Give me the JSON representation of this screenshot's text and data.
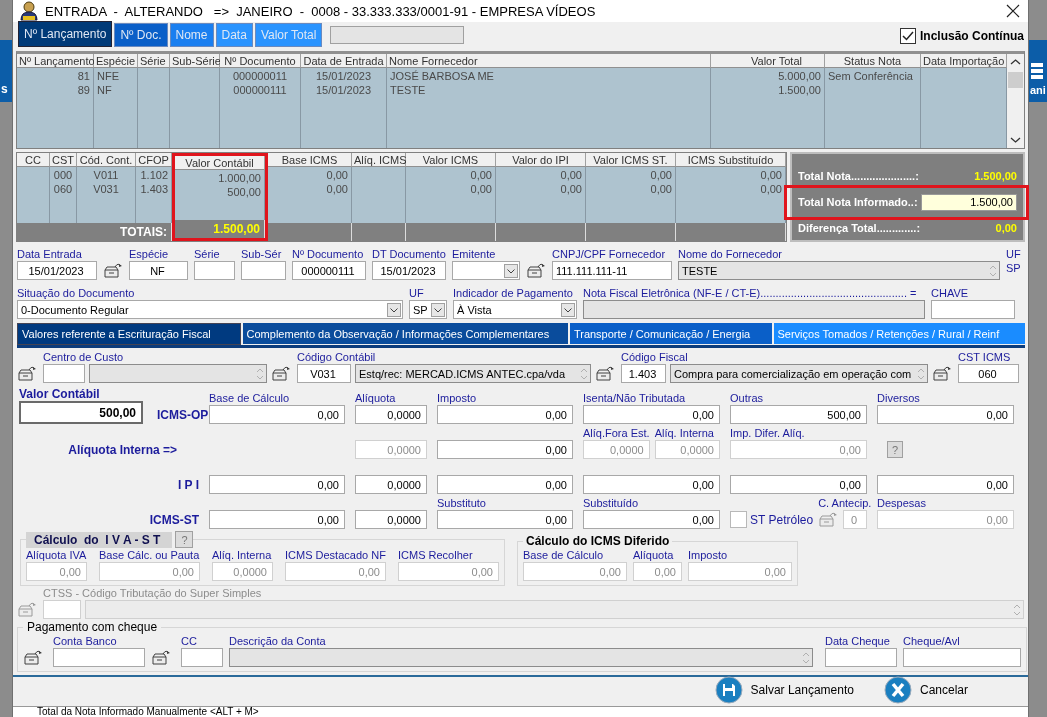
{
  "background_app": {
    "left_label": "s",
    "right_label": "ani"
  },
  "window": {
    "title": "ENTRADA  -  ALTERANDO   =>  JANEIRO  -  0008 - 33.333.333/0001-91 - EMPRESA VÍDEOS"
  },
  "search_tabs": [
    {
      "label": "Nº Lançamento",
      "selected": true
    },
    {
      "label": "Nº Doc.",
      "selected": false
    },
    {
      "label": "Nome",
      "selected": false
    },
    {
      "label": "Data",
      "selected": false
    },
    {
      "label": "Valor Total",
      "selected": false
    }
  ],
  "inclusao_continua": {
    "label": "Inclusão Contínua",
    "checked": true
  },
  "entries_table": {
    "columns": [
      "Nº Lançamento",
      "Espécie",
      "Série",
      "Sub-Série",
      "Nº Documento",
      "Data de Entrada",
      "Nome Fornecedor",
      "Valor Total",
      "Status Nota",
      "Data Importação"
    ],
    "rows": [
      [
        "81",
        "NFE",
        null,
        null,
        "000000011",
        "15/01/2023",
        "JOSÉ BARBOSA ME",
        "5.000,00",
        "Sem Conferência",
        null
      ],
      [
        "89",
        "NF",
        null,
        null,
        "000000111",
        "15/01/2023",
        "TESTE",
        "1.500,00",
        null,
        null
      ]
    ]
  },
  "items_table": {
    "columns": [
      {
        "label": "CC",
        "highlighted": false
      },
      {
        "label": "CST",
        "highlighted": false
      },
      {
        "label": "Cód. Cont.",
        "highlighted": false
      },
      {
        "label": "CFOP",
        "highlighted": false
      },
      {
        "label": "Valor Contábil",
        "highlighted": true
      },
      {
        "label": "Base ICMS",
        "highlighted": false
      },
      {
        "label": "Alíq. ICMS",
        "highlighted": false
      },
      {
        "label": "Valor ICMS",
        "highlighted": false
      },
      {
        "label": "Valor do IPI",
        "highlighted": false
      },
      {
        "label": "Valor ICMS ST.",
        "highlighted": false
      },
      {
        "label": "ICMS Substituído",
        "highlighted": false
      }
    ],
    "rows": [
      [
        null,
        "000",
        "V011",
        "1.102",
        "1.000,00",
        "0,00",
        null,
        "0,00",
        "0,00",
        "0,00",
        "0,00"
      ],
      [
        null,
        "060",
        "V031",
        "1.403",
        "500,00",
        "0,00",
        null,
        "0,00",
        "0,00",
        "0,00",
        "0,00"
      ]
    ],
    "totals": {
      "label": "TOTAIS:",
      "value": "1.500,00"
    }
  },
  "totals_panel": [
    {
      "kind": "text",
      "label": "Total Nota.....................:",
      "value": "1.500,00",
      "highlighted": false
    },
    {
      "kind": "input",
      "label": "Total Nota Informado..:",
      "value": "1.500,00",
      "highlighted": true
    },
    {
      "kind": "text",
      "label": "Diferença Total.............:",
      "value": "0,00",
      "highlighted": false
    }
  ],
  "document_rows": [
    [
      {
        "kind": "field",
        "label": "Data Entrada",
        "value": "15/01/2023",
        "disabled": false
      },
      {
        "kind": "lookup",
        "disabled": false
      },
      {
        "kind": "field",
        "label": "Espécie",
        "value": "NF",
        "disabled": false
      },
      {
        "kind": "field",
        "label": "Série",
        "disabled": false
      },
      {
        "kind": "field",
        "label": "Sub-Sér",
        "disabled": false
      },
      {
        "kind": "field",
        "label": "Nº Documento",
        "value": "000000111",
        "disabled": false
      },
      {
        "kind": "field",
        "label": "DT Documento",
        "value": "15/01/2023",
        "disabled": false
      },
      {
        "kind": "combo",
        "label": "Emitente",
        "disabled": false
      },
      {
        "kind": "lookup",
        "disabled": false
      },
      {
        "kind": "field",
        "label": "CNPJ/CPF Fornecedor",
        "value": "111.111.111-11",
        "disabled": false
      },
      {
        "kind": "spin",
        "label": "Nome do Fornecedor",
        "value": "TESTE",
        "disabled": false
      },
      {
        "kind": "label",
        "label": "UF",
        "value": "SP"
      }
    ],
    [
      {
        "kind": "combo",
        "label": "Situação do Documento",
        "value": "0-Documento Regular",
        "disabled": false
      },
      {
        "kind": "combo",
        "label": "UF",
        "value": "SP",
        "disabled": false
      },
      {
        "kind": "combo",
        "label": "Indicador de Pagamento",
        "value": "À Vista",
        "disabled": false
      },
      {
        "kind": "readonly",
        "label": "Nota Fiscal Eletrônica (NF-E / CT-E)................................................  =",
        "disabled": false
      },
      {
        "kind": "field",
        "label": "CHAVE",
        "disabled": false
      }
    ]
  ],
  "section_tabs": [
    {
      "label": "Valores referente a Escrituração Fiscal",
      "selected": true
    },
    {
      "label": "Complemento da Observação / Informações Complementares",
      "selected": false
    },
    {
      "label": "Transporte / Comunicação / Energia",
      "selected": false
    },
    {
      "label": "Serviços Tomados / Retenções / Rural / Reinf",
      "selected": false
    }
  ],
  "account_row": [
    {
      "kind": "lookup",
      "disabled": false
    },
    {
      "kind": "field",
      "label": "Centro de Custo",
      "disabled": false
    },
    {
      "kind": "spin",
      "disabled": false
    },
    {
      "kind": "lookup",
      "disabled": false
    },
    {
      "kind": "field",
      "label": "Código Contábil",
      "value": "V031",
      "disabled": false
    },
    {
      "kind": "spin",
      "value": "Estq/rec: MERCAD.ICMS ANTEC.cpa/vda",
      "disabled": false
    },
    {
      "kind": "lookup",
      "disabled": false
    },
    {
      "kind": "field",
      "label": "Código Fiscal",
      "value": "1.403",
      "disabled": false
    },
    {
      "kind": "spin",
      "value": "Compra para comercialização em operação com",
      "disabled": false
    },
    {
      "kind": "lookup",
      "disabled": false
    },
    {
      "kind": "field",
      "label": "CST ICMS",
      "value": "060",
      "disabled": false
    }
  ],
  "valor_contabil": {
    "label": "Valor Contábil",
    "value": "500,00"
  },
  "tax_rows": [
    {
      "label": "ICMS-OP",
      "cells": [
        {
          "kind": "field",
          "label": "Base de Cálculo",
          "value": "0,00",
          "disabled": false
        },
        {
          "kind": "field",
          "label": "Alíquota",
          "value": "0,0000",
          "disabled": false
        },
        {
          "kind": "field",
          "label": "Imposto",
          "value": "0,00",
          "disabled": false
        },
        {
          "kind": "field",
          "label": "Isenta/Não Tributada",
          "value": "0,00",
          "disabled": false
        },
        {
          "kind": "field",
          "label": "Outras",
          "value": "500,00",
          "disabled": false
        },
        {
          "kind": "field",
          "label": "Diversos",
          "value": "0,00",
          "disabled": false
        }
      ]
    },
    {
      "label": "Alíquota Interna =>",
      "cells": [
        {
          "kind": "field",
          "value": "0,0000",
          "disabled": true
        },
        {
          "kind": "field",
          "value": "0,00",
          "disabled": false
        },
        {
          "kind": "group",
          "items": [
            {
              "kind": "field",
              "label": "Alíq.Fora Est.",
              "value": "0,0000",
              "disabled": true
            },
            {
              "kind": "field",
              "label": "Alíq. Interna",
              "value": "0,0000",
              "disabled": true
            }
          ]
        },
        {
          "kind": "field",
          "label": "Imp. Difer. Alíq.",
          "value": "0,00",
          "disabled": true
        },
        {
          "kind": "help",
          "text": "?"
        }
      ]
    },
    {
      "label": "I P I",
      "cells": [
        {
          "kind": "field",
          "value": "0,00",
          "disabled": false
        },
        {
          "kind": "field",
          "value": "0,0000",
          "disabled": false
        },
        {
          "kind": "field",
          "value": "0,00",
          "disabled": false
        },
        {
          "kind": "field",
          "value": "0,00",
          "disabled": false
        },
        {
          "kind": "field",
          "value": "0,00",
          "disabled": false
        },
        {
          "kind": "field",
          "value": "0,00",
          "disabled": false
        }
      ]
    },
    {
      "label": "ICMS-ST",
      "cells": [
        {
          "kind": "field",
          "value": "0,00",
          "disabled": false
        },
        {
          "kind": "field",
          "value": "0,0000",
          "disabled": false
        },
        {
          "kind": "field",
          "label": "Substituto",
          "value": "0,00",
          "disabled": false
        },
        {
          "kind": "field",
          "label": "Substituído",
          "value": "0,00",
          "disabled": false
        },
        {
          "kind": "group",
          "items": [
            {
              "kind": "checkbox",
              "label": "ST Petróleo",
              "checked": false,
              "disabled": false
            },
            {
              "kind": "lookup",
              "label": "C. Antecip.",
              "disabled": true
            },
            {
              "kind": "field",
              "value": "0",
              "disabled": true
            }
          ]
        },
        {
          "kind": "field",
          "label": "Despesas",
          "value": "0,00",
          "disabled": true
        }
      ]
    }
  ],
  "iva_group": {
    "title": "Cálculo  do  I V A - S T",
    "help": "?",
    "fields": [
      {
        "kind": "field",
        "label": "Alíquota IVA",
        "value": "0,00",
        "disabled": true
      },
      {
        "kind": "field",
        "label": "Base Cálc. ou Pauta",
        "value": "0,00",
        "disabled": true
      },
      {
        "kind": "field",
        "label": "Alíq. Interna",
        "value": "0,0000",
        "disabled": true
      },
      {
        "kind": "field",
        "label": "ICMS Destacado NF",
        "value": "0,00",
        "disabled": true
      },
      {
        "kind": "field",
        "label": "ICMS Recolher",
        "value": "0,00",
        "disabled": true
      }
    ]
  },
  "diferido_group": {
    "title": "Cálculo do ICMS Diferido",
    "fields": [
      {
        "kind": "field",
        "label": "Base de Cálculo",
        "value": "0,00",
        "disabled": true
      },
      {
        "kind": "field",
        "label": "Alíquota",
        "value": "0,00",
        "disabled": true
      },
      {
        "kind": "field",
        "label": "Imposto",
        "value": "0,00",
        "disabled": true
      }
    ]
  },
  "ctss_row": {
    "label": "CTSS - Código Tributação do Super Simples",
    "disabled": true,
    "items": [
      {
        "kind": "lookup",
        "disabled": true
      },
      {
        "kind": "field",
        "disabled": true
      },
      {
        "kind": "spin",
        "disabled": true
      }
    ]
  },
  "cheque_group": {
    "title": "Pagamento com cheque",
    "items": [
      {
        "kind": "lookup",
        "disabled": false
      },
      {
        "kind": "field",
        "label": "Conta  Banco",
        "disabled": false
      },
      {
        "kind": "lookup",
        "disabled": false
      },
      {
        "kind": "field",
        "label": "CC",
        "disabled": false
      },
      {
        "kind": "spin",
        "label": "Descrição da Conta",
        "disabled": false
      },
      {
        "kind": "field",
        "label": "Data Cheque",
        "disabled": false
      },
      {
        "kind": "field",
        "label": "Cheque/Avl",
        "disabled": false
      }
    ]
  },
  "buttons": [
    {
      "kind": "save",
      "label": "Salvar Lançamento"
    },
    {
      "kind": "cancel",
      "label": "Cancelar"
    }
  ],
  "status_bar": {
    "text": "Total da Nota Informado Manualmente <ALT + M>"
  }
}
